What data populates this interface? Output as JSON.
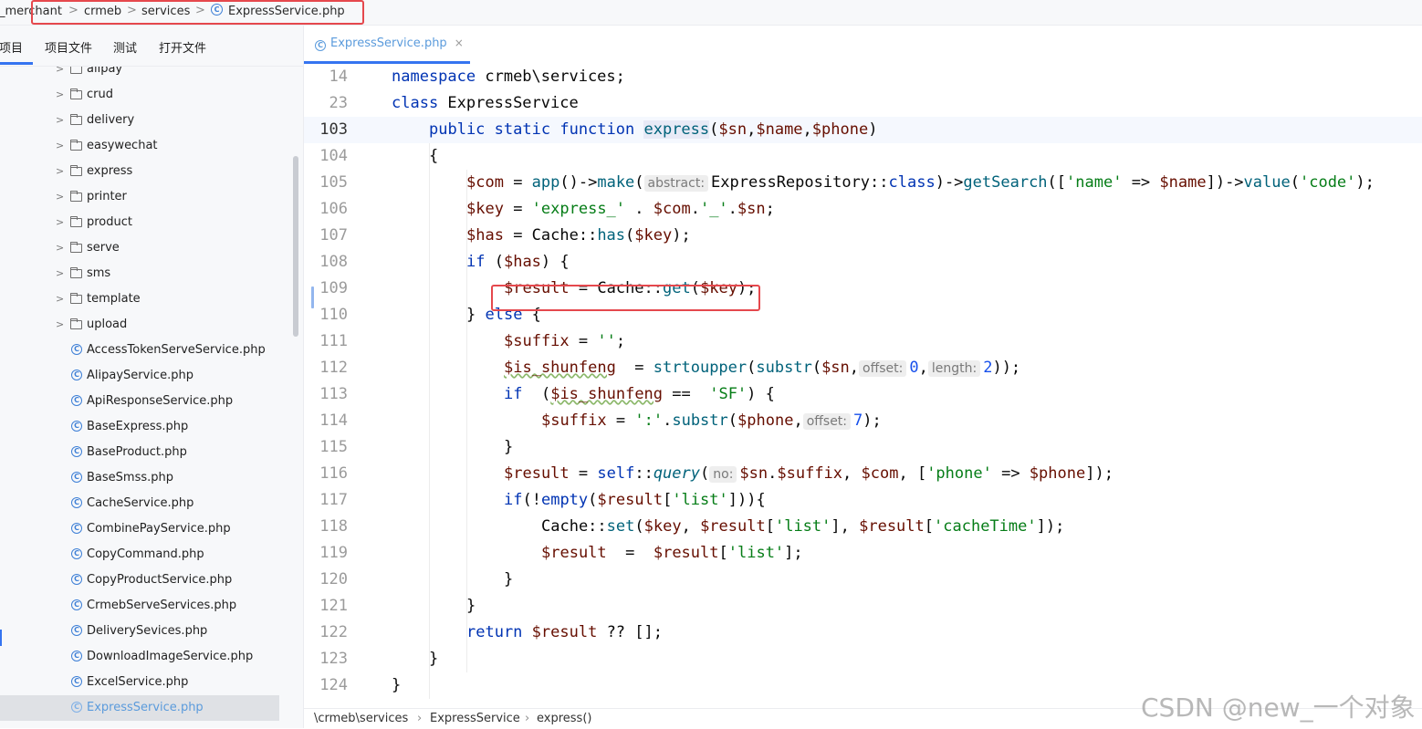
{
  "breadcrumb": {
    "items": [
      "_merchant",
      "crmeb",
      "services",
      "ExpressService.php"
    ],
    "separator": ">"
  },
  "project_tabs": [
    "项目",
    "项目文件",
    "测试",
    "打开文件"
  ],
  "tree": {
    "folders": [
      "alipay",
      "crud",
      "delivery",
      "easywechat",
      "express",
      "printer",
      "product",
      "serve",
      "sms",
      "template",
      "upload"
    ],
    "files": [
      "AccessTokenServeService.php",
      "AlipayService.php",
      "ApiResponseService.php",
      "BaseExpress.php",
      "BaseProduct.php",
      "BaseSmss.php",
      "CacheService.php",
      "CombinePayService.php",
      "CopyCommand.php",
      "CopyProductService.php",
      "CrmebServeServices.php",
      "DeliverySevices.php",
      "DownloadImageService.php",
      "ExcelService.php",
      "ExpressService.php"
    ],
    "selected_file": "ExpressService.php"
  },
  "editor": {
    "tab_label": "ExpressService.php",
    "tab_close": "×",
    "sticky_lines": [
      {
        "num": "14",
        "text": "namespace crmeb\\services;"
      },
      {
        "num": "23",
        "text": "class ExpressService"
      }
    ],
    "current_line": "103",
    "lines": [
      {
        "num": "103",
        "text": "public static function express($sn,$name,$phone)"
      },
      {
        "num": "104",
        "text": "{"
      },
      {
        "num": "105",
        "text": "$com = app()->make( abstract: ExpressRepository::class)->getSearch(['name' => $name])->value('code');"
      },
      {
        "num": "106",
        "text": "$key = 'express_' . $com.'_'.$sn;"
      },
      {
        "num": "107",
        "text": "$has = Cache::has($key);"
      },
      {
        "num": "108",
        "text": "if ($has) {"
      },
      {
        "num": "109",
        "text": "$result = Cache::get($key);"
      },
      {
        "num": "110",
        "text": "} else {"
      },
      {
        "num": "111",
        "text": "$suffix = '';"
      },
      {
        "num": "112",
        "text": "$is_shunfeng  = strtoupper(substr($sn, offset: 0, length: 2));"
      },
      {
        "num": "113",
        "text": "if  ($is_shunfeng ==  'SF') {"
      },
      {
        "num": "114",
        "text": "$suffix = ':'.substr($phone, offset: 7);"
      },
      {
        "num": "115",
        "text": "}"
      },
      {
        "num": "116",
        "text": "$result = self::query( no: $sn.$suffix, $com, ['phone' => $phone]);"
      },
      {
        "num": "117",
        "text": "if(!empty($result['list'])){"
      },
      {
        "num": "118",
        "text": "Cache::set($key, $result['list'], $result['cacheTime']);"
      },
      {
        "num": "119",
        "text": "$result  =  $result['list'];"
      },
      {
        "num": "120",
        "text": "}"
      },
      {
        "num": "121",
        "text": "}"
      },
      {
        "num": "122",
        "text": "return $result ?? [];"
      },
      {
        "num": "123",
        "text": "}"
      },
      {
        "num": "124",
        "text": "}"
      }
    ]
  },
  "status_path": [
    "\\crmeb\\services",
    "ExpressService",
    "express()"
  ],
  "watermark": "CSDN @new_一个对象",
  "colors": {
    "keyword": "#0033b3",
    "variable": "#660e00",
    "function": "#00627a",
    "string": "#067d17",
    "number": "#1750eb",
    "highlight_box": "#e5484d",
    "accent": "#3574f0"
  }
}
